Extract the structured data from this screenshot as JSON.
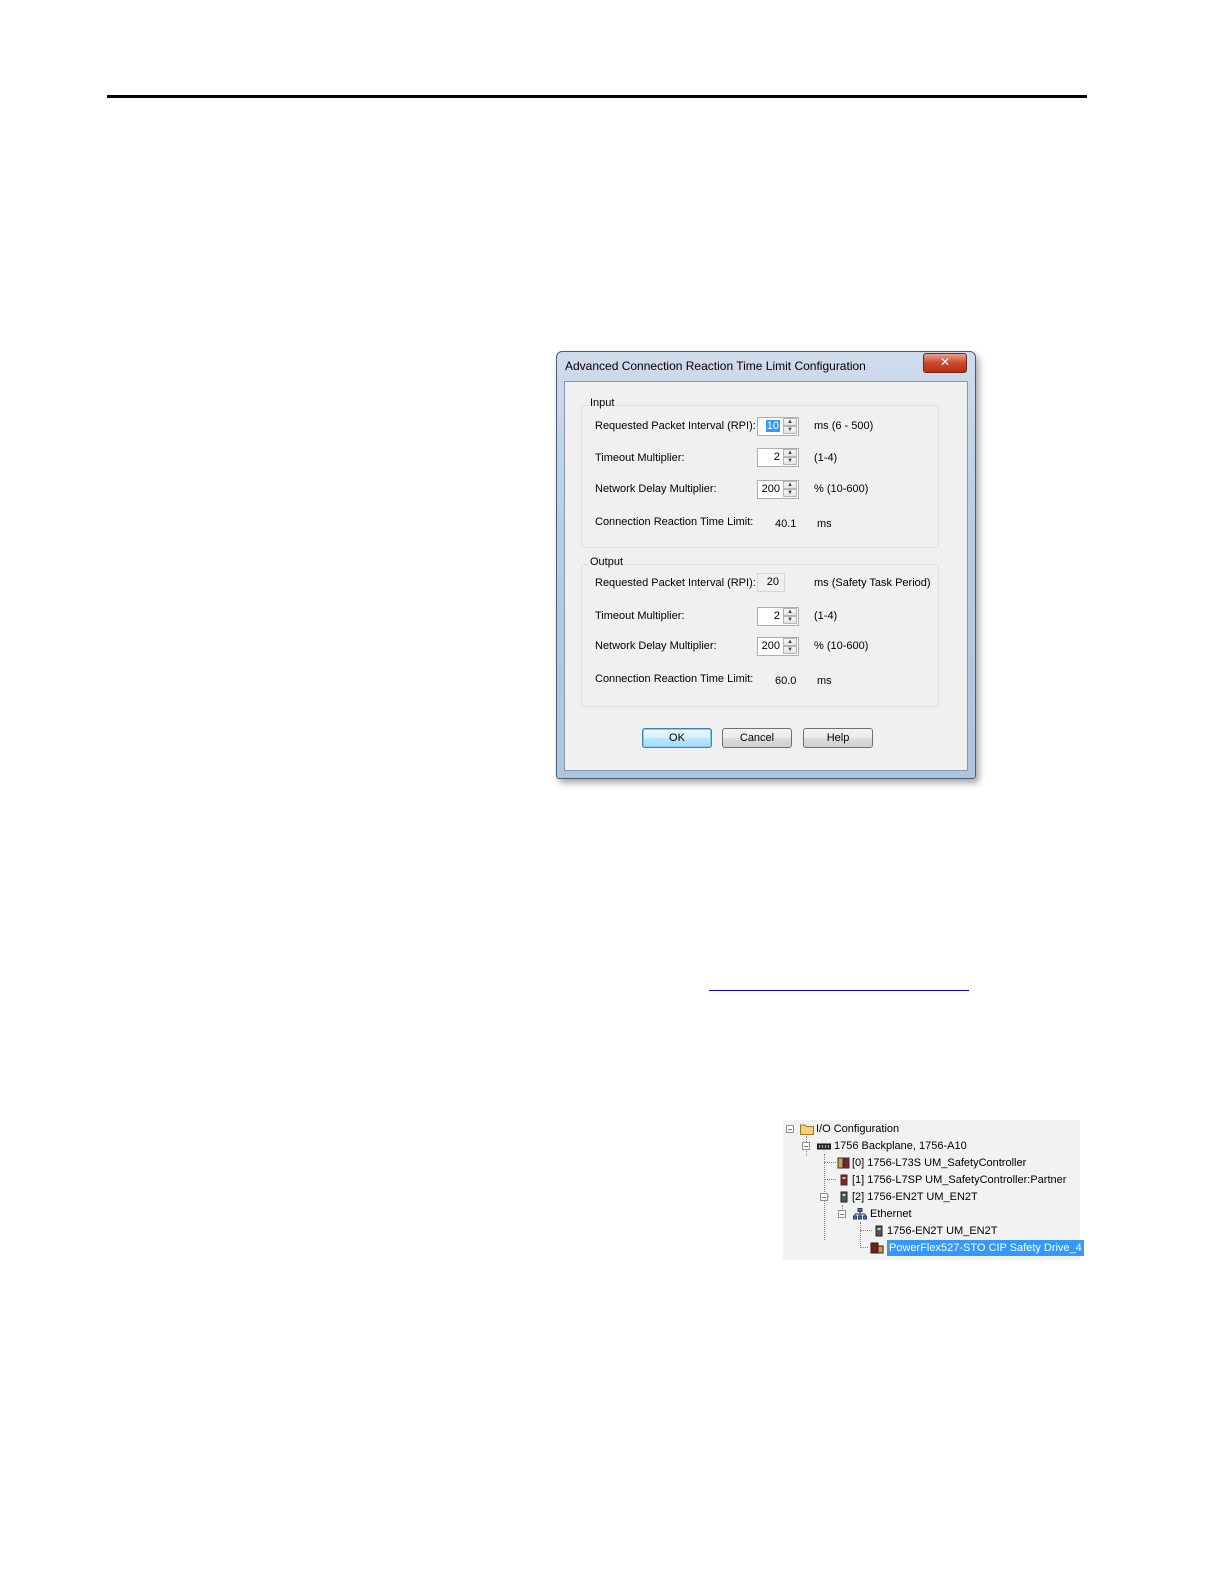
{
  "dialog": {
    "title": "Advanced Connection Reaction Time Limit Configuration",
    "close_glyph": "✕",
    "input": {
      "legend": "Input",
      "rpi_label": "Requested Packet Interval (RPI):",
      "rpi_value": "10",
      "rpi_range": "ms (6 - 500)",
      "timeout_label": "Timeout Multiplier:",
      "timeout_value": "2",
      "timeout_range": "(1-4)",
      "network_label": "Network Delay Multiplier:",
      "network_value": "200",
      "network_range": "% (10-600)",
      "crtl_label": "Connection Reaction Time Limit:",
      "crtl_value": "40.1",
      "crtl_unit": "ms"
    },
    "output": {
      "legend": "Output",
      "rpi_label": "Requested Packet Interval (RPI):",
      "rpi_value": "20",
      "rpi_range": "ms (Safety Task Period)",
      "timeout_label": "Timeout Multiplier:",
      "timeout_value": "2",
      "timeout_range": "(1-4)",
      "network_label": "Network Delay Multiplier:",
      "network_value": "200",
      "network_range": "% (10-600)",
      "crtl_label": "Connection Reaction Time Limit:",
      "crtl_value": "60.0",
      "crtl_unit": "ms"
    },
    "buttons": {
      "ok": "OK",
      "cancel": "Cancel",
      "help": "Help"
    }
  },
  "tree": {
    "items": [
      {
        "label": "I/O Configuration",
        "icon": "folder-icon"
      },
      {
        "label": "1756 Backplane, 1756-A10",
        "icon": "backplane-icon"
      },
      {
        "label": "[0] 1756-L73S UM_SafetyController",
        "icon": "safety-controller-icon"
      },
      {
        "label": "[1] 1756-L7SP UM_SafetyController:Partner",
        "icon": "partner-module-icon"
      },
      {
        "label": "[2] 1756-EN2T UM_EN2T",
        "icon": "ethernet-module-icon"
      },
      {
        "label": "Ethernet",
        "icon": "network-icon"
      },
      {
        "label": "1756-EN2T UM_EN2T",
        "icon": "ethernet-module-icon"
      },
      {
        "label": "PowerFlex527-STO CIP Safety Drive_4",
        "icon": "drive-icon"
      }
    ],
    "collapse_glyph": "−",
    "selection_color": "#3399ff"
  }
}
